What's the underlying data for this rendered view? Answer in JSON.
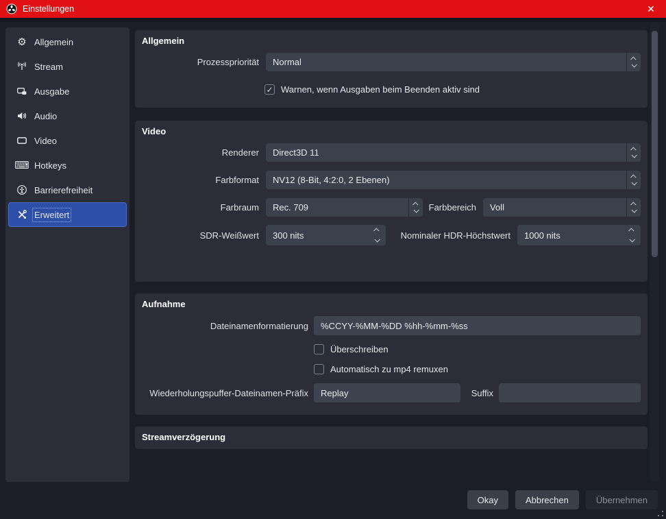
{
  "titlebar": {
    "title": "Einstellungen",
    "close_glyph": "✕",
    "bar_color": "#e01013"
  },
  "sidebar": {
    "items": [
      {
        "label": "Allgemein",
        "icon": "gear",
        "selected": false
      },
      {
        "label": "Stream",
        "icon": "broadcast",
        "selected": false
      },
      {
        "label": "Ausgabe",
        "icon": "output",
        "selected": false
      },
      {
        "label": "Audio",
        "icon": "speaker",
        "selected": false
      },
      {
        "label": "Video",
        "icon": "monitor",
        "selected": false
      },
      {
        "label": "Hotkeys",
        "icon": "keyboard",
        "selected": false
      },
      {
        "label": "Barrierefreiheit",
        "icon": "accessibility",
        "selected": false
      },
      {
        "label": "Erweitert",
        "icon": "tools",
        "selected": true
      }
    ],
    "selected_color": "#2d4fa7"
  },
  "sections": {
    "allgemein": {
      "title": "Allgemein",
      "prozess_label": "Prozesspriorität",
      "prozess_value": "Normal",
      "warn_label": "Warnen, wenn Ausgaben beim Beenden aktiv sind",
      "warn_checked": true
    },
    "video": {
      "title": "Video",
      "renderer_label": "Renderer",
      "renderer_value": "Direct3D 11",
      "farbformat_label": "Farbformat",
      "farbformat_value": "NV12 (8-Bit, 4:2:0, 2 Ebenen)",
      "farbraum_label": "Farbraum",
      "farbraum_value": "Rec. 709",
      "farbbereich_label": "Farbbereich",
      "farbbereich_value": "Voll",
      "sdr_label": "SDR-Weißwert",
      "sdr_value": "300 nits",
      "hdr_label": "Nominaler HDR-Höchstwert",
      "hdr_value": "1000 nits"
    },
    "aufnahme": {
      "title": "Aufnahme",
      "dateiname_label": "Dateinamenformatierung",
      "dateiname_value": "%CCYY-%MM-%DD %hh-%mm-%ss",
      "ueberschreiben_label": "Überschreiben",
      "ueberschreiben_checked": false,
      "remux_label": "Automatisch zu mp4 remuxen",
      "remux_checked": false,
      "praefix_label": "Wiederholungspuffer-Dateinamen-Präfix",
      "praefix_value": "Replay",
      "suffix_label": "Suffix",
      "suffix_value": ""
    },
    "delay": {
      "title": "Streamverzögerung"
    }
  },
  "footer": {
    "okay": "Okay",
    "abbrechen": "Abbrechen",
    "uebernehmen": "Übernehmen",
    "uebernehmen_disabled": true
  }
}
